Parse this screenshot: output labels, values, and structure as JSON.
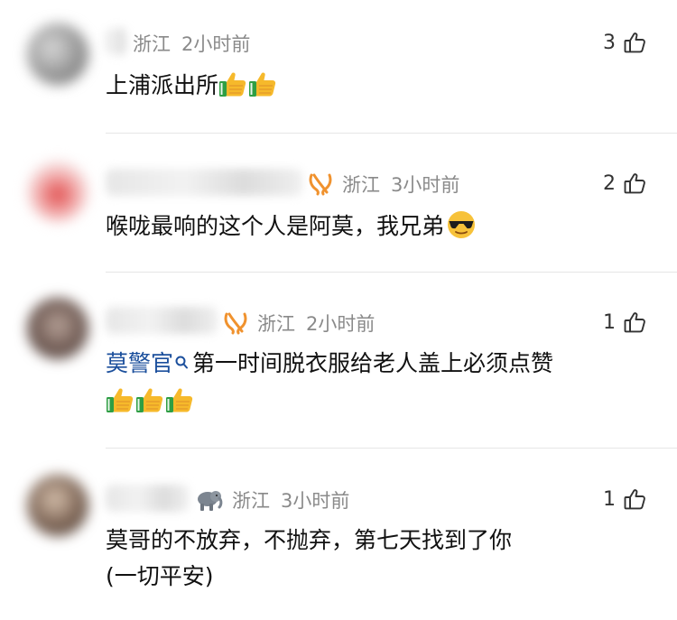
{
  "comments": [
    {
      "location": "浙江",
      "time": "2小时前",
      "likes": "3",
      "text": "上浦派出所",
      "emoji": [
        "thumbs-up",
        "thumbs-up"
      ]
    },
    {
      "location": "浙江",
      "time": "3小时前",
      "likes": "2",
      "text": "喉咙最响的这个人是阿莫，我兄弟",
      "emoji": [
        "cool-face"
      ],
      "badge": "orange-ribbon-icon"
    },
    {
      "location": "浙江",
      "time": "2小时前",
      "likes": "1",
      "mention": "莫警官",
      "text": "第一时间脱衣服给老人盖上必须点赞",
      "emoji": [
        "thumbs-up",
        "thumbs-up",
        "thumbs-up"
      ],
      "badge": "orange-ribbon-icon"
    },
    {
      "location": "浙江",
      "time": "3小时前",
      "likes": "1",
      "text_line1": "莫哥的不放弃，不抛弃，第七天找到了你",
      "text_line2": "(一切平安)",
      "badge": "elephant-icon"
    }
  ],
  "colors": {
    "meta": "#8a8a8a",
    "mention": "#1b4f9c",
    "ribbon": "#f0922e",
    "divider": "#e6e6e6"
  }
}
